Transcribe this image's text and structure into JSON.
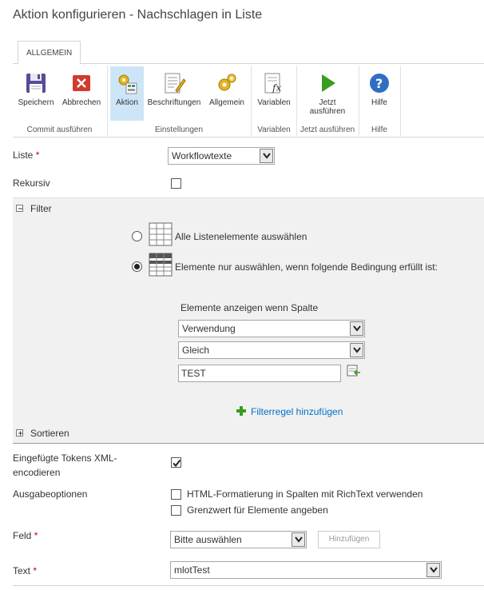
{
  "window": {
    "title": "Aktion konfigurieren - Nachschlagen in Liste"
  },
  "ribbon": {
    "tab": "ALLGEMEIN",
    "groups": {
      "commit": {
        "label": "Commit ausführen",
        "save": "Speichern",
        "cancel": "Abbrechen"
      },
      "settings": {
        "label": "Einstellungen",
        "action": "Aktion",
        "captions": "Beschriftungen",
        "general": "Allgemein"
      },
      "variables": {
        "label": "Variablen",
        "variables": "Variablen"
      },
      "run": {
        "label": "Jetzt ausführen",
        "run_line1": "Jetzt",
        "run_line2": "ausführen"
      },
      "help": {
        "label": "Hilfe",
        "help": "Hilfe"
      }
    }
  },
  "form": {
    "list": {
      "label": "Liste",
      "required_mark": "*",
      "value": "Workflowtexte"
    },
    "recursive": {
      "label": "Rekursiv",
      "checked": false
    },
    "filter": {
      "section_title": "Filter",
      "option_all": "Alle Listenelemente auswählen",
      "option_condition": "Elemente nur auswählen, wenn folgende Bedingung erfüllt ist:",
      "selected": "condition",
      "column_label": "Elemente anzeigen wenn Spalte",
      "column_value": "Verwendung",
      "operator_value": "Gleich",
      "compare_value": "TEST",
      "add_rule": "Filterregel hinzufügen"
    },
    "sort": {
      "section_title": "Sortieren"
    },
    "xml_encode": {
      "label_line1": "Eingefügte Tokens XML-",
      "label_line2": "encodieren",
      "checked": true
    },
    "output": {
      "label": "Ausgabeoptionen",
      "option_html": "HTML-Formatierung in Spalten mit RichText verwenden",
      "option_limit": "Grenzwert für Elemente angeben",
      "html_checked": false,
      "limit_checked": false
    },
    "field": {
      "label": "Feld",
      "required_mark": "*",
      "value": "Bitte auswählen",
      "add_button": "Hinzufügen"
    },
    "text": {
      "label": "Text",
      "required_mark": "*",
      "value": "mlotTest"
    }
  },
  "colors": {
    "accent": "#0072c6",
    "active_button": "#cde6f7",
    "required": "#cc0000",
    "add_icon": "#3a9b22"
  }
}
